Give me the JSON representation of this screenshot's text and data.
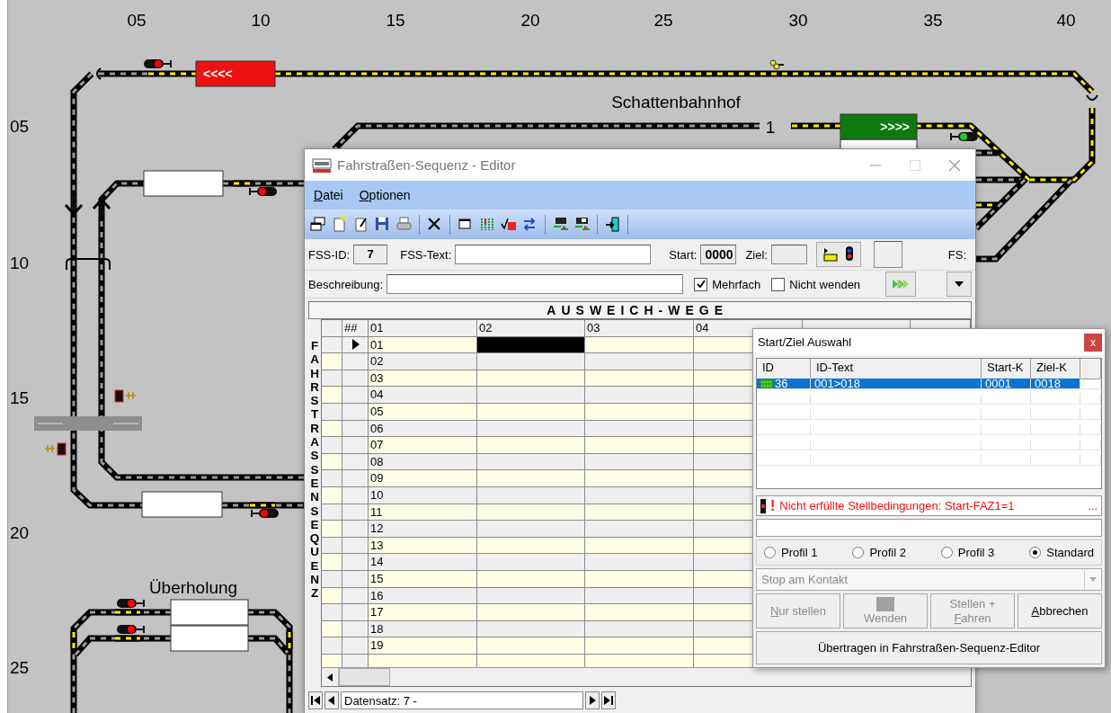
{
  "layout": {
    "column_labels": [
      "05",
      "10",
      "15",
      "20",
      "25",
      "30",
      "35",
      "40"
    ],
    "row_labels": [
      "05",
      "10",
      "15",
      "20",
      "25"
    ],
    "labels": [
      "Schattenbahnhof",
      "1",
      "Überholung"
    ],
    "trains": [
      {
        "text": "<<<<",
        "color": "#ee1111"
      },
      {
        "text": ">>>>",
        "color": "#0e7a0e"
      }
    ],
    "signals": [
      {
        "color": "#ff0000"
      },
      {
        "color": "#ff0000"
      },
      {
        "color": "#ff0000"
      },
      {
        "color": "#ff0000"
      },
      {
        "color": "#ff0000"
      },
      {
        "color": "#22cc22"
      }
    ]
  },
  "editor": {
    "title": "Fahrstraßen-Sequenz - Editor",
    "menu": [
      "Datei",
      "Optionen"
    ],
    "fss_id": {
      "label": "FSS-ID:",
      "value": "7"
    },
    "fss_text": {
      "label": "FSS-Text:"
    },
    "start": {
      "label": "Start:",
      "value": "0000"
    },
    "ziel": {
      "label": "Ziel:"
    },
    "fs_label": "FS:",
    "beschreibung": {
      "label": "Beschreibung:"
    },
    "checkboxes": [
      {
        "label": "Mehrfach",
        "checked": true
      },
      {
        "label": "Nicht wenden",
        "checked": false
      }
    ],
    "grid": {
      "title": "AUSWEICH-WEGE",
      "side_label": "FAHRSTRASSENSEQUENZ",
      "columns": [
        "##",
        "01",
        "02",
        "03",
        "04"
      ],
      "rows": [
        {
          "number": "01",
          "selected": true
        },
        {
          "number": "02",
          "selected": false
        },
        {
          "number": "03",
          "selected": false
        },
        {
          "number": "04",
          "selected": false
        },
        {
          "number": "05",
          "selected": false
        },
        {
          "number": "06",
          "selected": false
        },
        {
          "number": "07",
          "selected": false
        },
        {
          "number": "08",
          "selected": false
        },
        {
          "number": "09",
          "selected": false
        },
        {
          "number": "10",
          "selected": false
        },
        {
          "number": "11",
          "selected": false
        },
        {
          "number": "12",
          "selected": false
        },
        {
          "number": "13",
          "selected": false
        },
        {
          "number": "14",
          "selected": false
        },
        {
          "number": "15",
          "selected": false
        },
        {
          "number": "16",
          "selected": false
        },
        {
          "number": "17",
          "selected": false
        },
        {
          "number": "18",
          "selected": false
        },
        {
          "number": "19",
          "selected": false
        }
      ]
    },
    "navigator": {
      "text": "Datensatz: 7 -"
    }
  },
  "dialog": {
    "title": "Start/Ziel Auswahl",
    "close": "x",
    "columns": [
      "ID",
      "ID-Text",
      "Start-K",
      "Ziel-K"
    ],
    "rows": [
      {
        "cells": [
          "36",
          "001>018",
          "0001",
          "0018"
        ],
        "selected": true
      }
    ],
    "warning": {
      "mark": "!",
      "text": "Nicht erfüllte Stellbedingungen: Start-FAZ1=1",
      "more": "..."
    },
    "profiles": [
      {
        "label": "Profil 1",
        "selected": false
      },
      {
        "label": "Profil 2",
        "selected": false
      },
      {
        "label": "Profil 3",
        "selected": false
      },
      {
        "label": "Standard",
        "selected": true
      }
    ],
    "mode": {
      "value": "Stop am Kontakt",
      "disabled": true
    },
    "buttons": [
      {
        "kind": "text",
        "disabled": true,
        "lines": [
          {
            "text": "Nur stellen",
            "mnemonic": true
          }
        ]
      },
      {
        "kind": "icon",
        "disabled": true,
        "lines": [
          {
            "text": "Wenden",
            "mnemonic": false
          }
        ]
      },
      {
        "kind": "text",
        "disabled": true,
        "lines": [
          {
            "text": "Stellen +",
            "mnemonic": false
          },
          {
            "text": "Fahren",
            "mnemonic": true
          }
        ]
      },
      {
        "kind": "text",
        "disabled": false,
        "lines": [
          {
            "text": "Abbrechen",
            "mnemonic": true
          }
        ]
      }
    ],
    "transfer": "Übertragen in Fahrstraßen-Sequenz-Editor"
  }
}
